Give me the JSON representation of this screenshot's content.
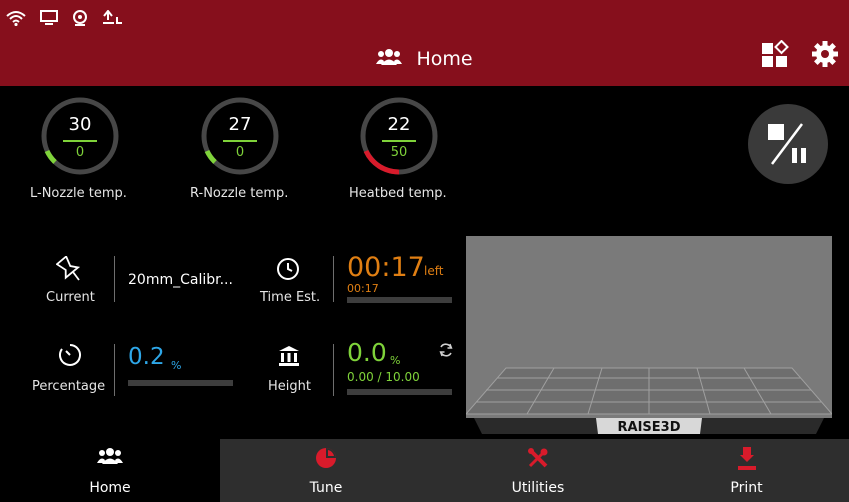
{
  "header": {
    "title": "Home",
    "status_icons": [
      "wifi-icon",
      "monitor-icon",
      "webcam-icon",
      "usb-icon"
    ],
    "right_icons": [
      "dashboard-layout-icon",
      "settings-gear-icon"
    ]
  },
  "temps": [
    {
      "current": "30",
      "target": "0",
      "label": "L-Nozzle temp."
    },
    {
      "current": "27",
      "target": "0",
      "label": "R-Nozzle temp."
    },
    {
      "current": "22",
      "target": "50",
      "label": "Heatbed temp."
    }
  ],
  "info": {
    "current_label": "Current",
    "file_name": "20mm_Calibr...",
    "time_label": "Time Est.",
    "time_value": "00:17",
    "time_suffix": "left",
    "time_sub": "00:17",
    "percentage_label": "Percentage",
    "percentage_value": "0.2",
    "percentage_unit": "%",
    "height_label": "Height",
    "height_value": "0.0",
    "height_unit": "%",
    "height_sub": "0.00 / 10.00"
  },
  "preview": {
    "brand": "RAISE3D"
  },
  "nav": [
    {
      "label": "Home",
      "icon": "group-icon"
    },
    {
      "label": "Tune",
      "icon": "pie-chart-icon"
    },
    {
      "label": "Utilities",
      "icon": "tools-icon"
    },
    {
      "label": "Print",
      "icon": "print-nozzle-icon"
    }
  ],
  "colors": {
    "header_bg": "#860f1c",
    "accent_red": "#d81b2b",
    "green": "#7fd33a",
    "orange": "#e07f13",
    "blue": "#2ea7e8"
  }
}
